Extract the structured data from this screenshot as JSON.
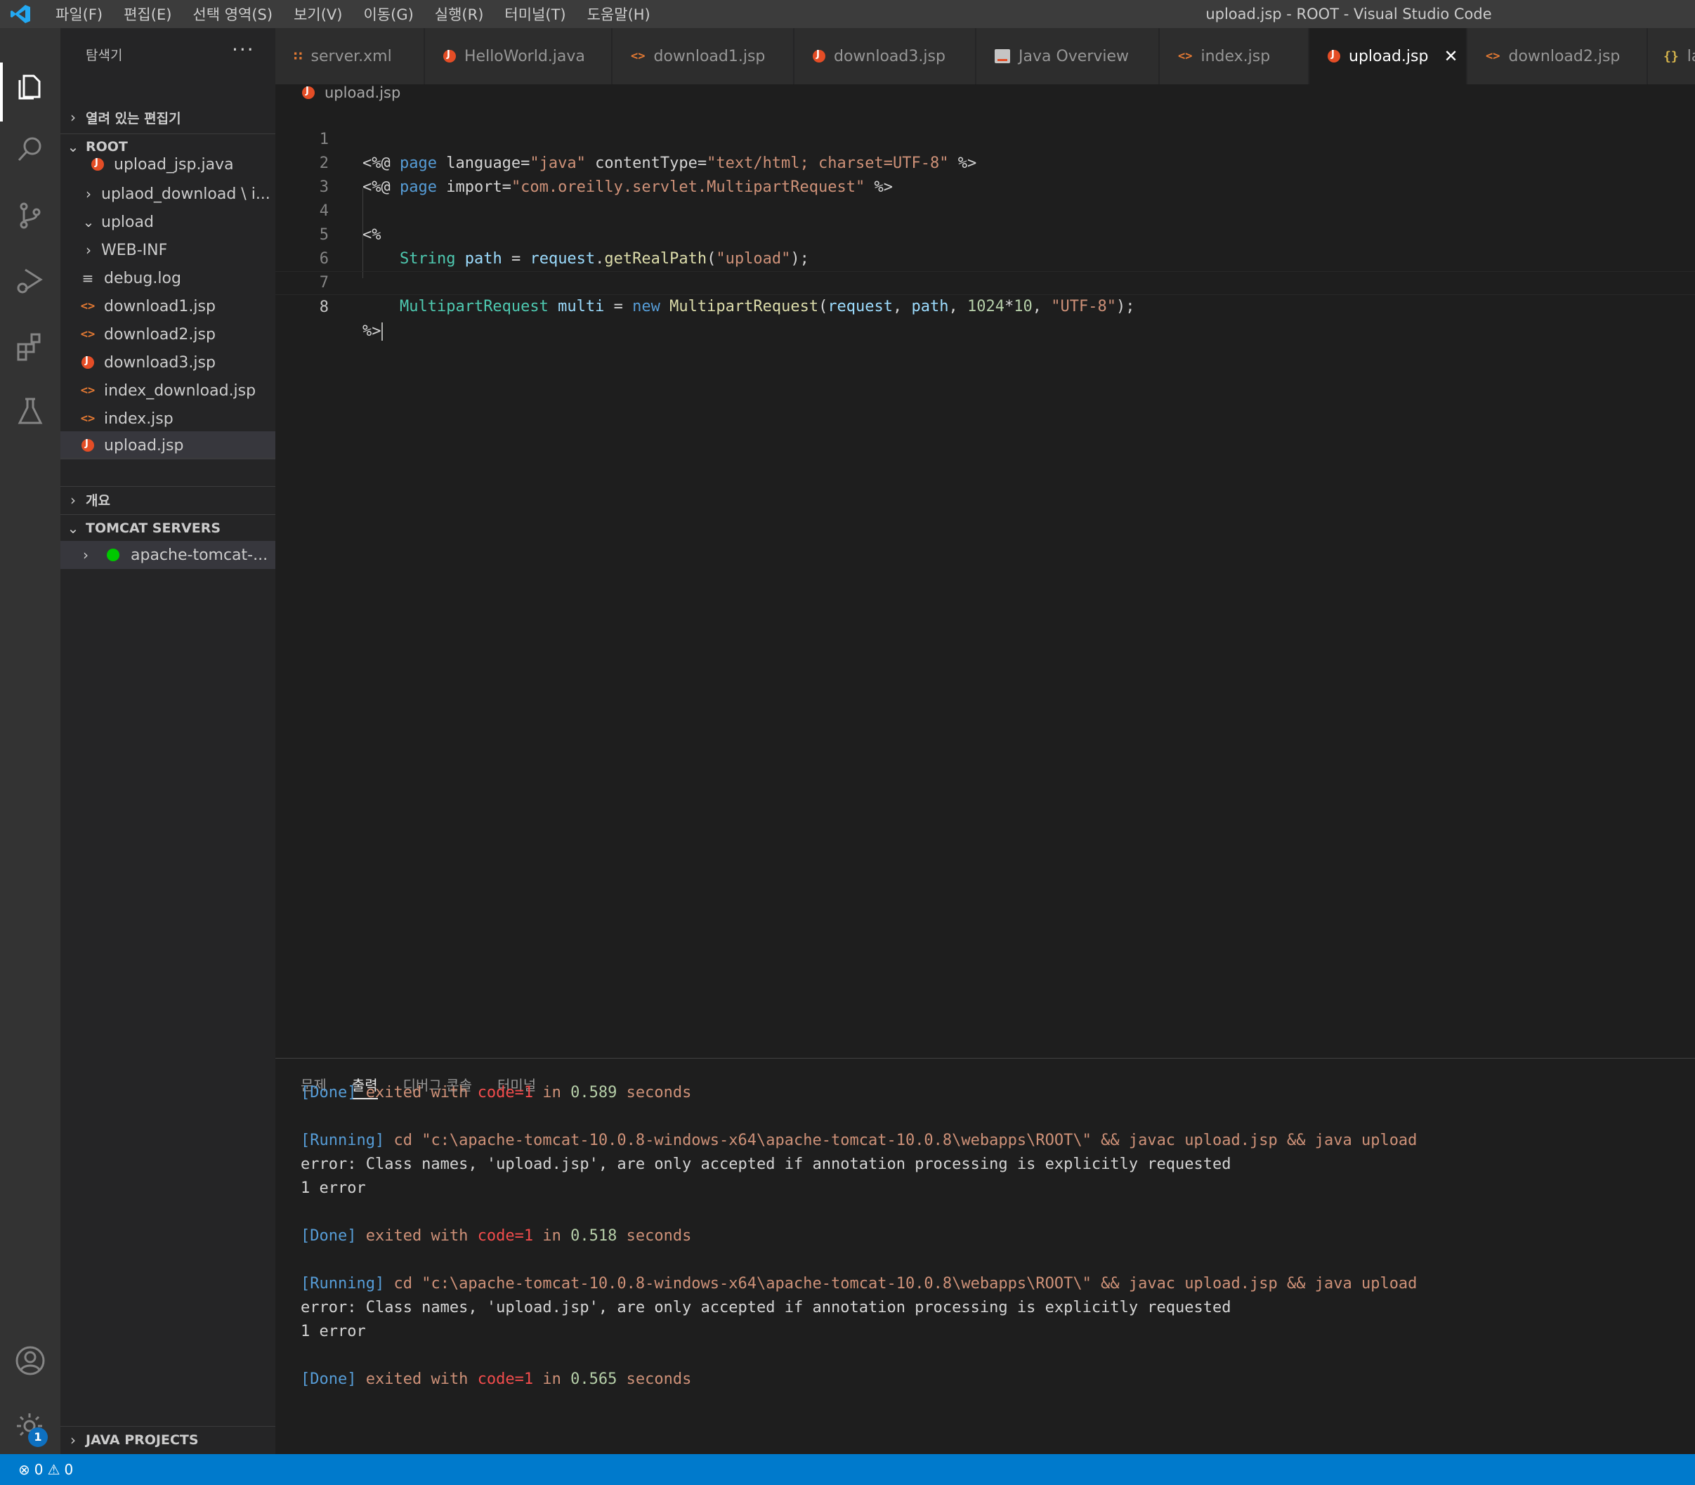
{
  "window": {
    "title": "upload.jsp - ROOT - Visual Studio Code"
  },
  "menu": [
    "파일(F)",
    "편집(E)",
    "선택 영역(S)",
    "보기(V)",
    "이동(G)",
    "실행(R)",
    "터미널(T)",
    "도움말(H)"
  ],
  "activity_bar": {
    "settings_badge": "1"
  },
  "sidebar": {
    "title": "탐색기",
    "more": "···",
    "open_editors": "열려 있는 편집기",
    "root": "ROOT",
    "items": [
      {
        "label": "upload_jsp.java",
        "icon": "java-icon"
      },
      {
        "label": "uplaod_download \\ i...",
        "icon": "chevron-right-icon"
      },
      {
        "label": "upload",
        "icon": "chevron-down-icon"
      },
      {
        "label": "WEB-INF",
        "icon": "chevron-right-icon"
      },
      {
        "label": "debug.log",
        "icon": "log-file-icon"
      },
      {
        "label": "download1.jsp",
        "icon": "jsp-icon"
      },
      {
        "label": "download2.jsp",
        "icon": "jsp-icon"
      },
      {
        "label": "download3.jsp",
        "icon": "java-icon"
      },
      {
        "label": "index_download.jsp",
        "icon": "jsp-icon"
      },
      {
        "label": "index.jsp",
        "icon": "jsp-icon"
      },
      {
        "label": "upload.jsp",
        "icon": "java-icon"
      }
    ],
    "outline": "개요",
    "tomcat": "TOMCAT SERVERS",
    "tomcat_server": "apache-tomcat-...",
    "java_projects": "JAVA PROJECTS"
  },
  "tabs": [
    {
      "label": "server.xml",
      "icon": "xml-icon"
    },
    {
      "label": "HelloWorld.java",
      "icon": "java-icon"
    },
    {
      "label": "download1.jsp",
      "icon": "jsp-icon"
    },
    {
      "label": "download3.jsp",
      "icon": "java-icon"
    },
    {
      "label": "Java Overview",
      "icon": "java-overview-icon"
    },
    {
      "label": "index.jsp",
      "icon": "jsp-icon"
    },
    {
      "label": "upload.jsp",
      "icon": "java-icon",
      "active": true
    },
    {
      "label": "download2.jsp",
      "icon": "jsp-icon"
    },
    {
      "label": "la",
      "icon": "json-icon"
    }
  ],
  "breadcrumb": "upload.jsp",
  "editor": {
    "line_numbers": [
      "1",
      "2",
      "3",
      "4",
      "5",
      "6",
      "7",
      "8"
    ],
    "lines": [
      "<%@ page language=\"java\" contentType=\"text/html; charset=UTF-8\" %>",
      "<%@ page import=\"com.oreilly.servlet.MultipartRequest\" %>",
      "",
      "<%",
      "    String path = request.getRealPath(\"upload\");",
      "",
      "    MultipartRequest multi = new MultipartRequest(request, path, 1024*10, \"UTF-8\");",
      "%>"
    ]
  },
  "panel": {
    "tabs": [
      "문제",
      "출력",
      "디버그 콘솔",
      "터미널"
    ],
    "active_tab": "출력",
    "output": [
      "[Done] exited with code=1 in 0.589 seconds",
      "",
      "[Running] cd \"c:\\apache-tomcat-10.0.8-windows-x64\\apache-tomcat-10.0.8\\webapps\\ROOT\\\" && javac upload.jsp && java upload",
      "error: Class names, 'upload.jsp', are only accepted if annotation processing is explicitly requested",
      "1 error",
      "",
      "[Done] exited with code=1 in 0.518 seconds",
      "",
      "[Running] cd \"c:\\apache-tomcat-10.0.8-windows-x64\\apache-tomcat-10.0.8\\webapps\\ROOT\\\" && javac upload.jsp && java upload",
      "error: Class names, 'upload.jsp', are only accepted if annotation processing is explicitly requested",
      "1 error",
      "",
      "[Done] exited with code=1 in 0.565 seconds"
    ]
  },
  "status": {
    "errors": "0",
    "warnings": "0"
  },
  "colors": {
    "accent": "#007acc",
    "active_tab_bg": "#1e1e1e",
    "server_running": "#00c800"
  }
}
